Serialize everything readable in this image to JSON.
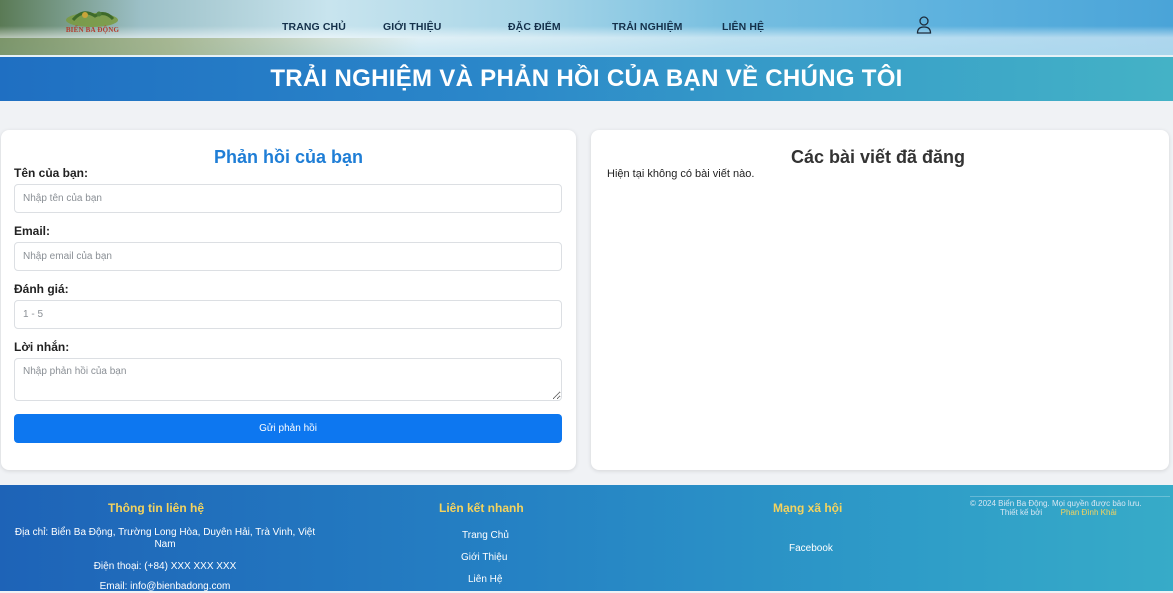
{
  "header": {
    "logo_text": "BIỂN BA ĐỘNG",
    "nav": [
      "TRANG CHỦ",
      "GIỚI THIỆU",
      "ĐẶC ĐIỂM",
      "TRẢI NGHIỆM",
      "LIÊN HỆ"
    ]
  },
  "banner": {
    "title": "TRẢI NGHIỆM VÀ PHẢN HỒI CỦA BẠN VỀ CHÚNG TÔI"
  },
  "form": {
    "title": "Phản hồi của bạn",
    "name_label": "Tên của bạn:",
    "name_placeholder": "Nhập tên của bạn",
    "email_label": "Email:",
    "email_placeholder": "Nhập email của bạn",
    "rating_label": "Đánh giá:",
    "rating_placeholder": "1 - 5",
    "message_label": "Lời nhắn:",
    "message_placeholder": "Nhập phản hồi của bạn",
    "submit_label": "Gửi phản hồi"
  },
  "posts": {
    "title": "Các bài viết đã đăng",
    "empty_text": "Hiện tại không có bài viết nào."
  },
  "footer": {
    "contact_title": "Thông tin liên hệ",
    "address": "Địa chỉ: Biển Ba Động, Trường Long Hòa, Duyên Hải, Trà Vinh, Việt Nam",
    "phone": "Điện thoại: (+84) XXX XXX XXX",
    "email": "Email:      info@bienbadong.com",
    "links_title": "Liên kết nhanh",
    "links": [
      "Trang Chủ",
      "Giới Thiệu",
      "Liên Hệ"
    ],
    "social_title": "Mạng xã hội",
    "social_link": "Facebook",
    "copyright": "© 2024 Biển Ba Động. Mọi quyền được bảo lưu.",
    "designed_by": "Thiết kế bởi",
    "author": "Phan Đình Khải"
  },
  "colors": {
    "accent": "#0d77f0",
    "form_title": "#1f7ed6",
    "footer_heading": "#f4d35e",
    "title_band": "#2a86c9"
  },
  "icons": [
    "user-icon"
  ]
}
